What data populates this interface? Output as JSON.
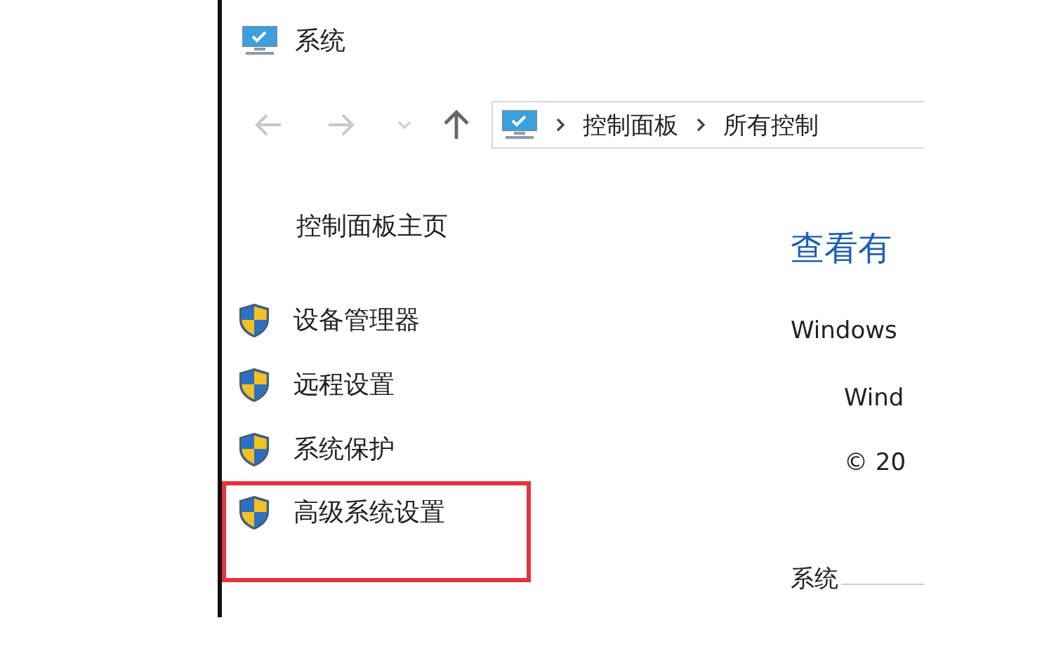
{
  "window": {
    "title": "系统"
  },
  "nav_buttons": [
    {
      "kind": "back",
      "disabled": true
    },
    {
      "kind": "forward",
      "disabled": true
    },
    {
      "kind": "recent",
      "disabled": true
    },
    {
      "kind": "up",
      "disabled": false
    }
  ],
  "address": {
    "segments": [
      "控制面板",
      "所有控制"
    ]
  },
  "sidebar": {
    "home": "控制面板主页",
    "items": [
      {
        "label": "设备管理器",
        "highlighted": false
      },
      {
        "label": "远程设置",
        "highlighted": false
      },
      {
        "label": "系统保护",
        "highlighted": false
      },
      {
        "label": "高级系统设置",
        "highlighted": true
      }
    ]
  },
  "main": {
    "heading": "查看有",
    "edition_label": "Windows",
    "edition": "Wind",
    "copyright": "© 20",
    "section": "系统"
  }
}
